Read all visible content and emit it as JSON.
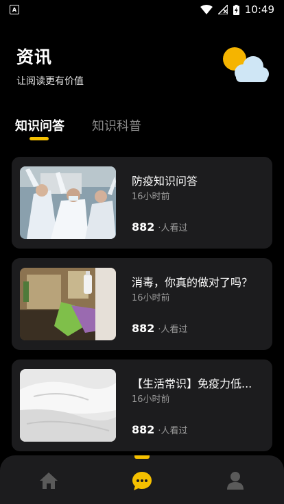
{
  "status": {
    "time": "10:49",
    "notification_glyph": "A"
  },
  "header": {
    "title": "资讯",
    "subtitle": "让阅读更有价值"
  },
  "tabs": [
    {
      "label": "知识问答",
      "active": true
    },
    {
      "label": "知识科普",
      "active": false
    }
  ],
  "articles": [
    {
      "title": "防疫知识问答",
      "time": "16小时前",
      "views": "882",
      "views_label": "·人看过",
      "image": "medical-staff-cheering-photo"
    },
    {
      "title": "消毒，你真的做对了吗？",
      "time": "16小时前",
      "views": "882",
      "views_label": "·人看过",
      "image": "disinfecting-table-photo"
    },
    {
      "title": "【生活常识】免疫力低...",
      "time": "16小时前",
      "views": "882",
      "views_label": "·人看过",
      "image": "white-pillows-bed-photo"
    }
  ],
  "bottom_nav": [
    {
      "icon": "home-icon",
      "active": false
    },
    {
      "icon": "chat-icon",
      "active": true
    },
    {
      "icon": "user-icon",
      "active": false
    }
  ],
  "colors": {
    "accent": "#f5c000",
    "card_bg": "#1c1c1e",
    "background": "#000000"
  }
}
